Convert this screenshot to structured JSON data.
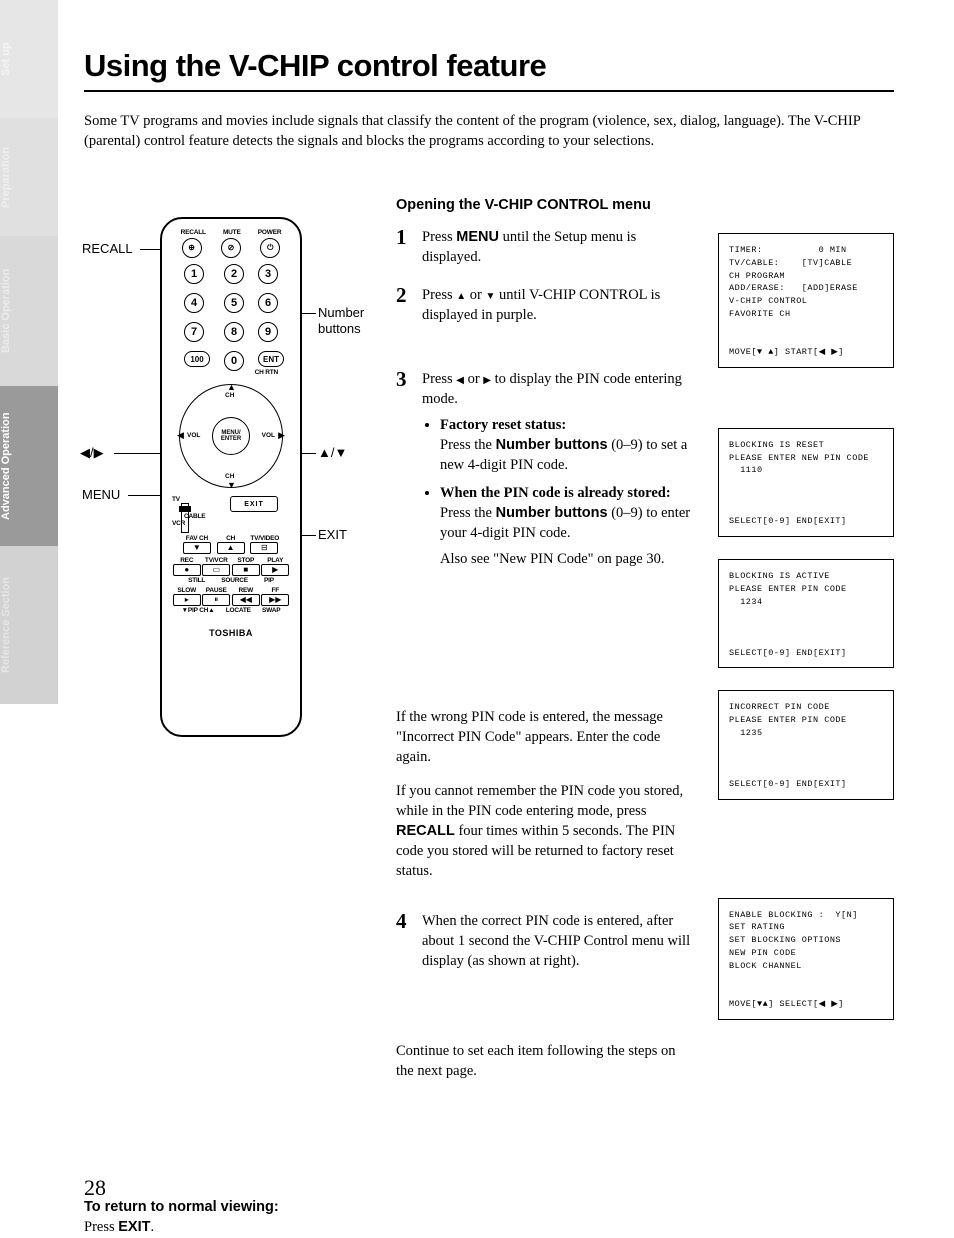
{
  "page_number": "28",
  "tabs": {
    "setup": "Set up",
    "preparation": "Preparation",
    "basic": "Basic Operation",
    "advanced": "Advanced Operation",
    "reference": "Reference Section"
  },
  "title": "Using the V-CHIP control feature",
  "intro": "Some TV programs and movies include signals that classify the content of the program (violence, sex, dialog, language). The V-CHIP (parental) control feature detects the signals and blocks the programs according to your selections.",
  "left": {
    "callouts": {
      "recall": "RECALL",
      "number_buttons": "Number buttons",
      "lr": "◀/▶",
      "ud": "▲/▼",
      "menu": "MENU",
      "exit": "EXIT"
    },
    "remote": {
      "top_labels": {
        "recall": "RECALL",
        "mute": "MUTE",
        "power": "POWER"
      },
      "numbers": [
        "1",
        "2",
        "3",
        "4",
        "5",
        "6",
        "7",
        "8",
        "9",
        "100",
        "0",
        "ENT"
      ],
      "ch_rtn": "CH RTN",
      "dpad": {
        "ch": "CH",
        "vol": "VOL",
        "center": "MENU/\nENTER"
      },
      "switch": {
        "tv": "TV",
        "cable": "CABLE",
        "vcr": "VCR"
      },
      "exit": "EXIT",
      "row_a": {
        "favch": "FAV CH",
        "ch": "CH",
        "tvvideo": "TV/VIDEO"
      },
      "row_b": {
        "rec": "REC",
        "tvvcr": "TV/VCR",
        "stop": "STOP",
        "play": "PLAY"
      },
      "row_c": {
        "slow": "SLOW",
        "pause": "PAUSE",
        "rew": "REW",
        "ff": "FF"
      },
      "row_d": {
        "still": "STILL",
        "source": "SOURCE",
        "pip": "PIP"
      },
      "row_e": {
        "pipch": "▼PIP CH▲",
        "locate": "LOCATE",
        "swap": "SWAP"
      },
      "brand": "TOSHIBA"
    },
    "return_note_bold": "To return to normal viewing:",
    "return_note_rest_a": "Press ",
    "return_note_rest_b": "EXIT",
    "return_note_rest_c": "."
  },
  "center": {
    "subhead": "Opening the V-CHIP CONTROL menu",
    "step1_a": "Press ",
    "step1_b": "MENU",
    "step1_c": " until the Setup menu is displayed.",
    "step2_a": "Press ",
    "step2_b": " or ",
    "step2_c": " until V-CHIP CONTROL is displayed in purple.",
    "step3_a": "Press ",
    "step3_b": " or ",
    "step3_c": " to display the PIN code entering mode.",
    "step3_bullet1_title": "Factory reset status:",
    "step3_bullet1_a": "Press the ",
    "step3_bullet1_b": "Number buttons",
    "step3_bullet1_c": " (0–9) to set a new 4-digit PIN code.",
    "step3_bullet2_title": "When the PIN code is already stored:",
    "step3_bullet2_a": "Press the ",
    "step3_bullet2_b": "Number buttons",
    "step3_bullet2_c": " (0–9) to enter your 4-digit PIN code.",
    "step3_bullet2_d": "Also see \"New PIN Code\" on page 30.",
    "wrongpin_a": "If the wrong PIN code is entered, the message \"Incorrect PIN Code\" appears. Enter the code again.",
    "wrongpin_b1": "If you cannot remember the PIN code you stored, while in the PIN code entering mode, press ",
    "wrongpin_b2": "RECALL",
    "wrongpin_b3": " four times within 5 seconds. The PIN code you stored will be returned to factory reset status.",
    "step4": "When the correct PIN code is entered, after about 1 second the V-CHIP Control menu will display (as shown at right).",
    "continue": "Continue to set each item following the steps on the next page."
  },
  "osd": {
    "menu": "TIMER:          0 MIN\nTV/CABLE:    [TV]CABLE\nCH PROGRAM\nADD/ERASE:   [ADD]ERASE\nV-CHIP CONTROL\nFAVORITE CH\n\n\nMOVE[▼ ▲] START[◀ ▶]",
    "reset": "BLOCKING IS RESET\nPLEASE ENTER NEW PIN CODE\n  1110\n\n\n\nSELECT[0-9] END[EXIT]",
    "active": "BLOCKING IS ACTIVE\nPLEASE ENTER PIN CODE\n  1234\n\n\n\nSELECT[0-9] END[EXIT]",
    "incorrect": "INCORRECT PIN CODE\nPLEASE ENTER PIN CODE\n  1235\n\n\n\nSELECT[0-9] END[EXIT]",
    "vchip": "ENABLE BLOCKING :  Y[N]\nSET RATING\nSET BLOCKING OPTIONS\nNEW PIN CODE\nBLOCK CHANNEL\n\n\nMOVE[▼▲] SELECT[◀ ▶]"
  }
}
